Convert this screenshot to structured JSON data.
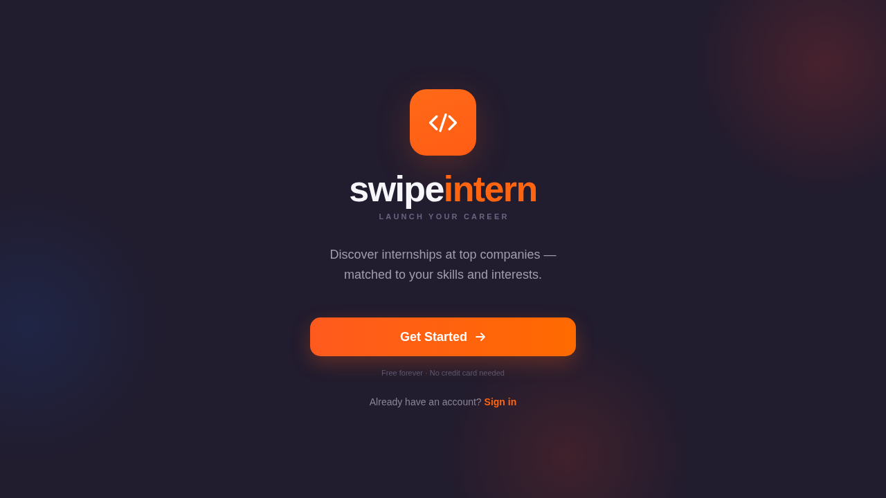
{
  "brand": {
    "name_start": "swipe",
    "name_end": "intern",
    "tagline": "LAUNCH YOUR CAREER"
  },
  "description": "Discover internships at top companies — matched to your skills and interests.",
  "primary_button": {
    "label": "Get Started"
  },
  "note": "Free forever · No credit card needed",
  "sign_in_prompt": {
    "text": "Already have an account?",
    "link": "Sign in"
  }
}
